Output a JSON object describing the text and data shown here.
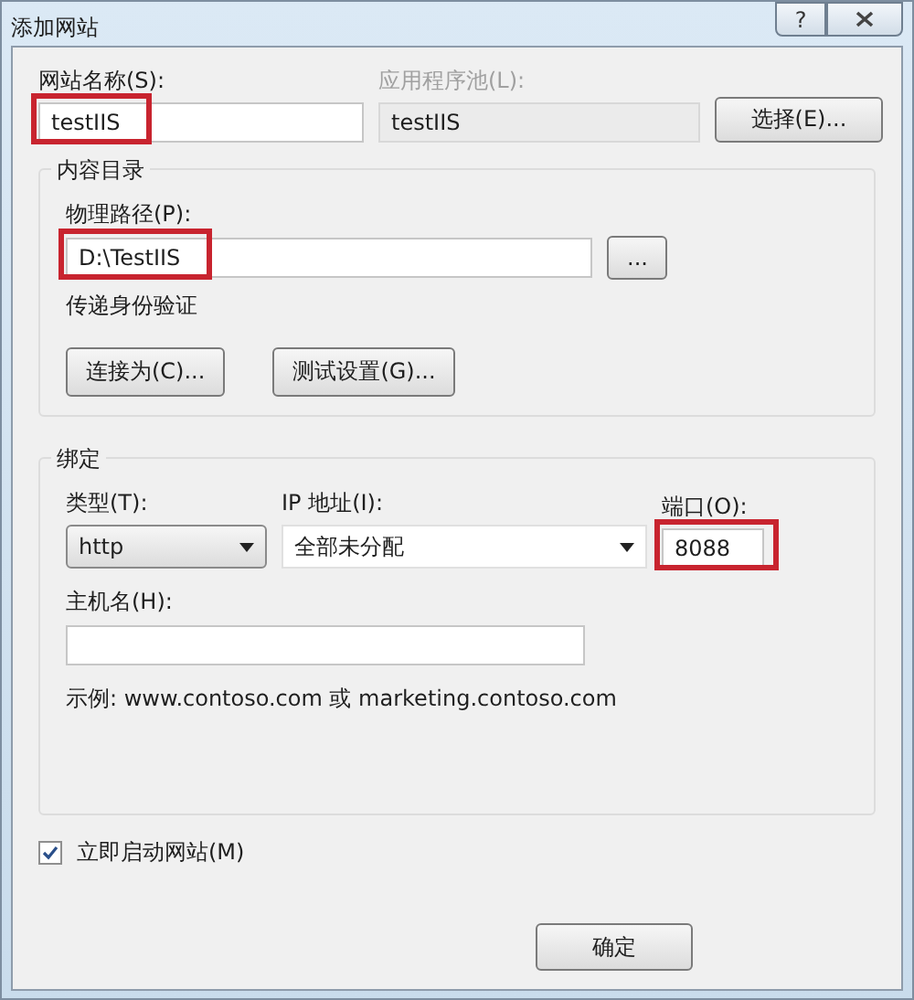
{
  "window": {
    "title": "添加网站",
    "help_button": "?"
  },
  "site_name": {
    "label": "网站名称(S):",
    "value": "testIIS",
    "highlighted": true
  },
  "app_pool": {
    "label": "应用程序池(L):",
    "value": "testIIS",
    "disabled": true,
    "button": "选择(E)..."
  },
  "content": {
    "title": "内容目录",
    "path": {
      "label": "物理路径(P):",
      "value": "D:\\TestIIS",
      "highlighted": true,
      "button": "..."
    },
    "auth_label": "传递身份验证",
    "buttons": [
      "连接为(C)...",
      "测试设置(G)..."
    ]
  },
  "binding": {
    "title": "绑定",
    "type": {
      "label": "类型(T):",
      "value": "http"
    },
    "ip": {
      "label": "IP 地址(I):",
      "value": "全部未分配"
    },
    "port": {
      "label": "端口(O):",
      "value": "8088",
      "highlighted": true
    },
    "host": {
      "label": "主机名(H):"
    },
    "example": "示例: www.contoso.com 或 marketing.contoso.com"
  },
  "start_now": {
    "label": "立即启动网站(M)",
    "checked": true
  },
  "buttons": [
    "确定"
  ]
}
